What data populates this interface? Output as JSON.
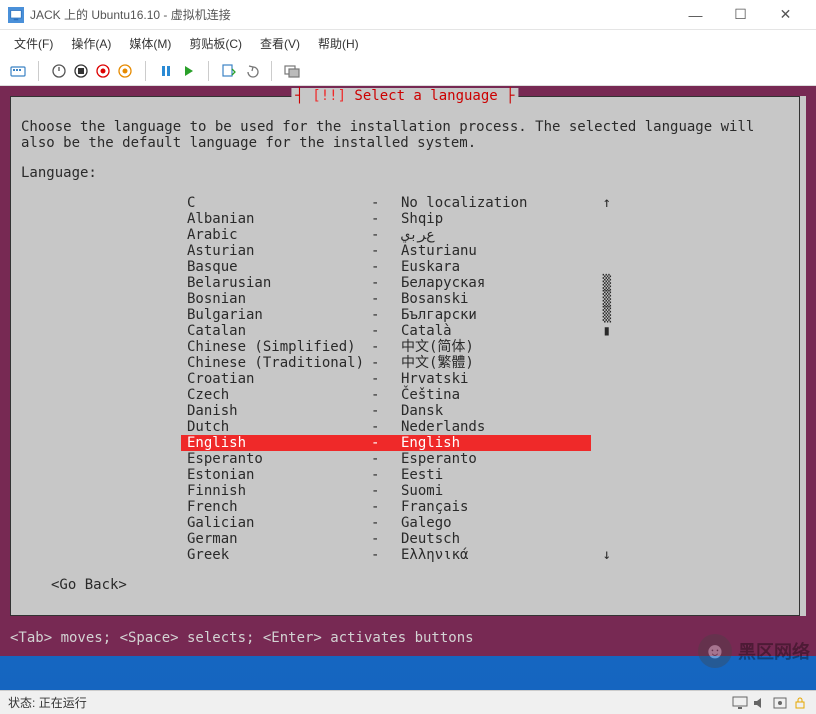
{
  "window": {
    "title": "JACK 上的 Ubuntu16.10 - 虚拟机连接"
  },
  "menu": {
    "file": "文件(F)",
    "action": "操作(A)",
    "media": "媒体(M)",
    "clipboard": "剪贴板(C)",
    "view": "查看(V)",
    "help": "帮助(H)"
  },
  "installer": {
    "box_title": "[!!] Select a language",
    "box_title_left": "[!!]",
    "box_title_right": " Select a language",
    "description": "Choose the language to be used for the installation process. The selected language will\nalso be the default language for the installed system.",
    "label": "Language:",
    "scroll_up": "↑",
    "scroll_down": "↓",
    "scroll_marker": "▒",
    "scroll_thumb": "▮",
    "go_back": "<Go Back>",
    "languages": [
      {
        "name": "C",
        "native": "No localization"
      },
      {
        "name": "Albanian",
        "native": "Shqip"
      },
      {
        "name": "Arabic",
        "native": "ﻉﺮﺑﻱ"
      },
      {
        "name": "Asturian",
        "native": "Asturianu"
      },
      {
        "name": "Basque",
        "native": "Euskara"
      },
      {
        "name": "Belarusian",
        "native": "Беларуская"
      },
      {
        "name": "Bosnian",
        "native": "Bosanski"
      },
      {
        "name": "Bulgarian",
        "native": "Български"
      },
      {
        "name": "Catalan",
        "native": "Català"
      },
      {
        "name": "Chinese (Simplified)",
        "native": "中文(简体)"
      },
      {
        "name": "Chinese (Traditional)",
        "native": "中文(繁體)"
      },
      {
        "name": "Croatian",
        "native": "Hrvatski"
      },
      {
        "name": "Czech",
        "native": "Čeština"
      },
      {
        "name": "Danish",
        "native": "Dansk"
      },
      {
        "name": "Dutch",
        "native": "Nederlands"
      },
      {
        "name": "English",
        "native": "English"
      },
      {
        "name": "Esperanto",
        "native": "Esperanto"
      },
      {
        "name": "Estonian",
        "native": "Eesti"
      },
      {
        "name": "Finnish",
        "native": "Suomi"
      },
      {
        "name": "French",
        "native": "Français"
      },
      {
        "name": "Galician",
        "native": "Galego"
      },
      {
        "name": "German",
        "native": "Deutsch"
      },
      {
        "name": "Greek",
        "native": "Ελληνικά"
      }
    ],
    "selected_index": 15,
    "hint": "<Tab> moves; <Space> selects; <Enter> activates buttons"
  },
  "status": {
    "label": "状态:",
    "value": "正在运行"
  },
  "watermark": {
    "text": "黑区网络"
  }
}
